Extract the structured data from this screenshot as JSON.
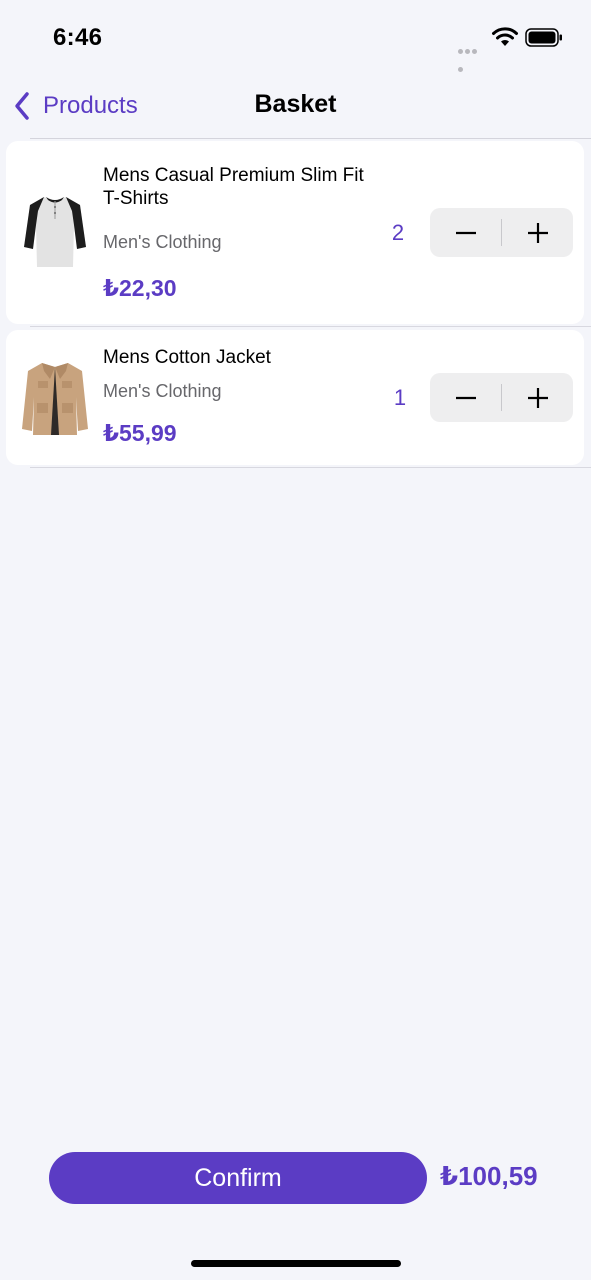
{
  "status": {
    "time": "6:46"
  },
  "nav": {
    "back_label": "Products",
    "title": "Basket"
  },
  "items": [
    {
      "name": "Mens Casual Premium Slim Fit T-Shirts",
      "category": "Men's Clothing",
      "price": "₺22,30",
      "quantity": "2",
      "image_icon": "raglan-tshirt-image"
    },
    {
      "name": "Mens Cotton Jacket",
      "category": "Men's Clothing",
      "price": "₺55,99",
      "quantity": "1",
      "image_icon": "cotton-jacket-image"
    }
  ],
  "footer": {
    "confirm_label": "Confirm",
    "total": "₺100,59"
  },
  "colors": {
    "accent": "#5b3cc4",
    "background": "#f4f5fa",
    "card": "#ffffff",
    "stepper": "#eeeeef"
  }
}
